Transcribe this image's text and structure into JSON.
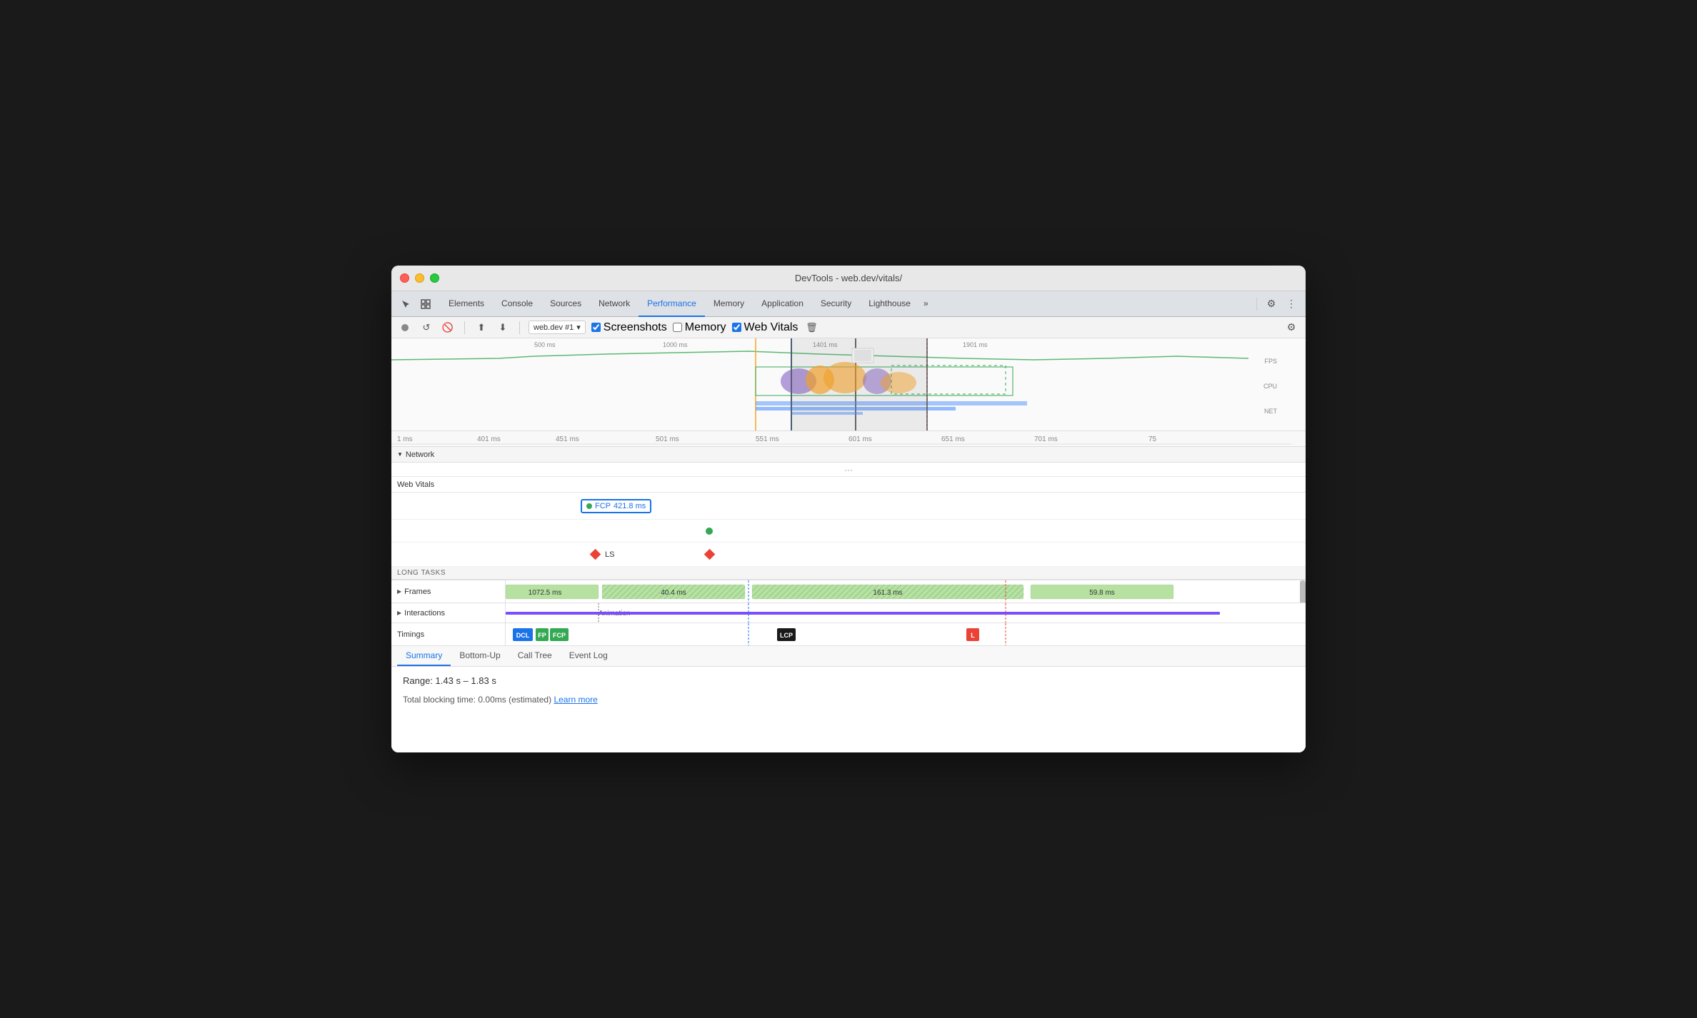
{
  "window": {
    "title": "DevTools - web.dev/vitals/"
  },
  "tabs": [
    {
      "id": "elements",
      "label": "Elements",
      "active": false
    },
    {
      "id": "console",
      "label": "Console",
      "active": false
    },
    {
      "id": "sources",
      "label": "Sources",
      "active": false
    },
    {
      "id": "network",
      "label": "Network",
      "active": false
    },
    {
      "id": "performance",
      "label": "Performance",
      "active": true
    },
    {
      "id": "memory",
      "label": "Memory",
      "active": false
    },
    {
      "id": "application",
      "label": "Application",
      "active": false
    },
    {
      "id": "security",
      "label": "Security",
      "active": false
    },
    {
      "id": "lighthouse",
      "label": "Lighthouse",
      "active": false
    }
  ],
  "toolbar": {
    "session_label": "web.dev #1",
    "screenshots_label": "Screenshots",
    "memory_label": "Memory",
    "web_vitals_label": "Web Vitals"
  },
  "timeline": {
    "overview_marks": [
      "500 ms",
      "1000 ms",
      "1401 ms",
      "1901 ms"
    ],
    "main_marks": [
      "1 ms",
      "401 ms",
      "451 ms",
      "501 ms",
      "551 ms",
      "601 ms",
      "651 ms",
      "701 ms",
      "75"
    ],
    "right_labels": [
      "FPS",
      "CPU",
      "NET"
    ]
  },
  "web_vitals": {
    "header": "Web Vitals",
    "fcp_label": "FCP",
    "fcp_value": "421.8 ms",
    "ls_label": "LS",
    "long_tasks_label": "LONG TASKS"
  },
  "tracks": {
    "network_label": "Network",
    "frames_label": "Frames",
    "interactions_label": "Interactions",
    "interactions_sublabel": "Animation",
    "timings_label": "Timings",
    "frames": [
      {
        "value": "1072.5 ms"
      },
      {
        "value": "40.4 ms"
      },
      {
        "value": "161.3 ms"
      },
      {
        "value": "59.8 ms"
      }
    ],
    "timings": [
      {
        "label": "DCL",
        "color": "#1a73e8"
      },
      {
        "label": "FP",
        "color": "#34a853"
      },
      {
        "label": "FCP",
        "color": "#34a853"
      },
      {
        "label": "LCP",
        "color": "#1a1a1a"
      },
      {
        "label": "L",
        "color": "#ea4335"
      }
    ]
  },
  "bottom_tabs": [
    {
      "label": "Summary",
      "active": true
    },
    {
      "label": "Bottom-Up",
      "active": false
    },
    {
      "label": "Call Tree",
      "active": false
    },
    {
      "label": "Event Log",
      "active": false
    }
  ],
  "summary": {
    "range": "Range: 1.43 s – 1.83 s",
    "total_blocking": "Total blocking time: 0.00ms (estimated)",
    "learn_more": "Learn more"
  }
}
